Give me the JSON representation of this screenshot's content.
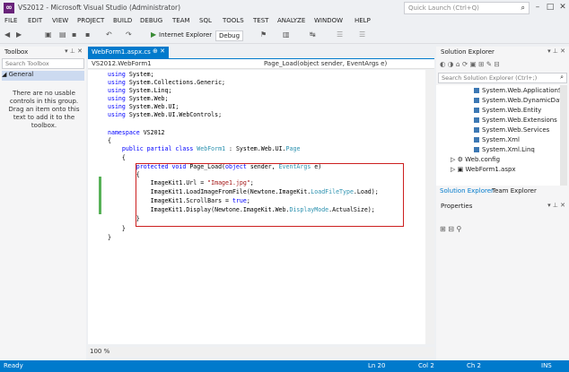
{
  "window": {
    "title": "VS2012 - Microsoft Visual Studio (Administrator)",
    "quick_launch": "Quick Launch (Ctrl+Q)"
  },
  "menu": [
    "FILE",
    "EDIT",
    "VIEW",
    "PROJECT",
    "BUILD",
    "DEBUG",
    "TEAM",
    "SQL",
    "TOOLS",
    "TEST",
    "ANALYZE",
    "WINDOW",
    "HELP"
  ],
  "toolbar": {
    "browser": "Internet Explorer",
    "config": "Debug"
  },
  "toolbox": {
    "title": "Toolbox",
    "search_placeholder": "Search Toolbox",
    "group": "◢ General",
    "message": "There are no usable controls in this group. Drag an item onto this text to add it to the toolbox."
  },
  "editor": {
    "tab": "WebForm1.aspx.cs",
    "nav_left": "VS2012.WebForm1",
    "nav_right": "Page_Load(object sender, EventArgs e)",
    "lines": [
      "using System;",
      "using System.Collections.Generic;",
      "using System.Linq;",
      "using System.Web;",
      "using System.Web.UI;",
      "using System.Web.UI.WebControls;",
      "",
      "namespace VS2012",
      "{",
      "    public partial class WebForm1 : System.Web.UI.Page",
      "    {",
      "        protected void Page_Load(object sender, EventArgs e)",
      "        {",
      "            ImageKit1.Url = \"Image1.jpg\";",
      "            ImageKit1.LoadImageFromFile(Newtone.ImageKit.LoadFileType.Load);",
      "            ImageKit1.ScrollBars = true;",
      "            ImageKit1.Display(Newtone.ImageKit.Web.DisplayMode.ActualSize);",
      "        }",
      "    }",
      "}"
    ],
    "zoom": "100 %"
  },
  "solution_explorer": {
    "title": "Solution Explorer",
    "search_placeholder": "Search Solution Explorer (Ctrl+;)",
    "items": [
      "System.Web.ApplicationSe",
      "System.Web.DynamicData",
      "System.Web.Entity",
      "System.Web.Extensions",
      "System.Web.Services",
      "System.Xml",
      "System.Xml.Linq",
      "Web.config",
      "WebForm1.aspx"
    ],
    "tabs": [
      "Solution Explorer",
      "Team Explorer"
    ]
  },
  "properties": {
    "title": "Properties"
  },
  "status": {
    "ready": "Ready",
    "ln": "Ln 20",
    "col": "Col 2",
    "ch": "Ch 2",
    "ins": "INS"
  },
  "colors": {
    "accent": "#007acc",
    "highlight_box": "#cc1f1f",
    "changed_bar": "#57b157"
  }
}
